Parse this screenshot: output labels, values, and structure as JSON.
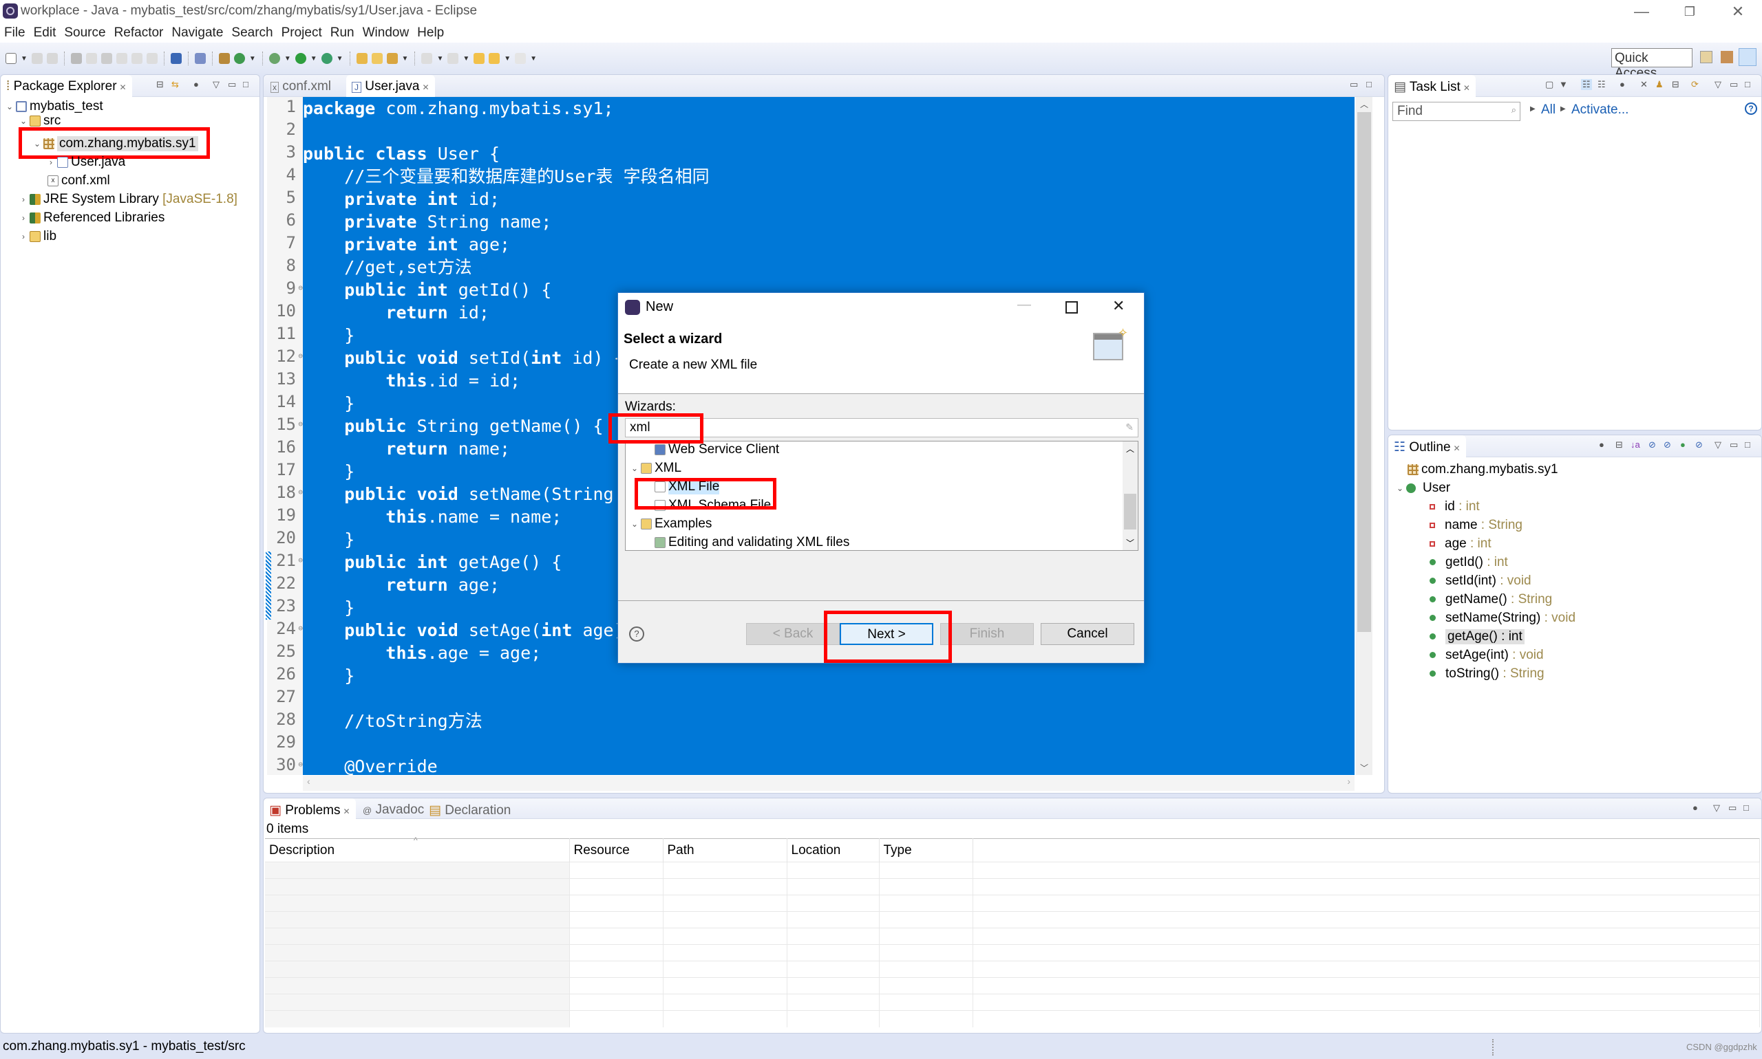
{
  "window": {
    "title": "workplace - Java - mybatis_test/src/com/zhang/mybatis/sy1/User.java - Eclipse",
    "controls": {
      "minimize": "—",
      "restore": "❐",
      "close": "✕"
    }
  },
  "menu": [
    "File",
    "Edit",
    "Source",
    "Refactor",
    "Navigate",
    "Search",
    "Project",
    "Run",
    "Window",
    "Help"
  ],
  "toolbar": {
    "quick_access": "Quick Access"
  },
  "package_explorer": {
    "tab_label": "Package Explorer",
    "tree": [
      {
        "label": "mybatis_test",
        "icon": "project-icon",
        "level": 0,
        "expanded": true
      },
      {
        "label": "src",
        "icon": "source-folder-icon",
        "level": 1,
        "expanded": true
      },
      {
        "label": "com.zhang.mybatis.sy1",
        "icon": "package-icon",
        "level": 2,
        "expanded": true,
        "selected": true
      },
      {
        "label": "User.java",
        "icon": "java-file-icon",
        "level": 3,
        "expanded": false
      },
      {
        "label": "conf.xml",
        "icon": "xml-file-icon",
        "level": 2
      },
      {
        "label": "JRE System Library",
        "decoration": "[JavaSE-1.8]",
        "icon": "library-icon",
        "level": 1,
        "expanded": false
      },
      {
        "label": "Referenced Libraries",
        "icon": "library-icon",
        "level": 1,
        "expanded": false
      },
      {
        "label": "lib",
        "icon": "folder-icon",
        "level": 1,
        "expanded": false
      }
    ]
  },
  "editor": {
    "tabs": [
      {
        "label": "conf.xml",
        "active": false
      },
      {
        "label": "User.java",
        "active": true
      }
    ],
    "lines": [
      "package com.zhang.mybatis.sy1;",
      "",
      "public class User {",
      "    //三个变量要和数据库建的User表 字段名相同",
      "    private int id;",
      "    private String name;",
      "    private int age;",
      "    //get,set方法",
      "    public int getId() {",
      "        return id;",
      "    }",
      "    public void setId(int id) {",
      "        this.id = id;",
      "    }",
      "    public String getName() {",
      "        return name;",
      "    }",
      "    public void setName(String name) {",
      "        this.name = name;",
      "    }",
      "    public int getAge() {",
      "        return age;",
      "    }",
      "    public void setAge(int age) {",
      "        this.age = age;",
      "    }",
      "",
      "    //toString方法",
      "",
      "    @Override"
    ],
    "fold_lines": [
      9,
      12,
      15,
      18,
      21,
      24,
      30
    ]
  },
  "task_list": {
    "tab_label": "Task List",
    "find_placeholder": "Find",
    "all_link": "All",
    "activate_link": "Activate...",
    "help": "?"
  },
  "outline": {
    "tab_label": "Outline",
    "items": [
      {
        "name": "com.zhang.mybatis.sy1",
        "type": "",
        "kind": "package"
      },
      {
        "name": "User",
        "type": "",
        "kind": "class"
      },
      {
        "name": "id",
        "type": " : int",
        "kind": "field"
      },
      {
        "name": "name",
        "type": " : String",
        "kind": "field"
      },
      {
        "name": "age",
        "type": " : int",
        "kind": "field"
      },
      {
        "name": "getId()",
        "type": " : int",
        "kind": "method"
      },
      {
        "name": "setId(int)",
        "type": " : void",
        "kind": "method"
      },
      {
        "name": "getName()",
        "type": " : String",
        "kind": "method"
      },
      {
        "name": "setName(String)",
        "type": " : void",
        "kind": "method"
      },
      {
        "name": "getAge()",
        "type": " : int",
        "kind": "method",
        "selected": true
      },
      {
        "name": "setAge(int)",
        "type": " : void",
        "kind": "method"
      },
      {
        "name": "toString()",
        "type": " : String",
        "kind": "method-override"
      }
    ]
  },
  "problems": {
    "tabs": [
      {
        "label": "Problems",
        "active": true
      },
      {
        "label": "Javadoc",
        "active": false
      },
      {
        "label": "Declaration",
        "active": false
      }
    ],
    "count": "0 items",
    "columns": [
      "Description",
      "Resource",
      "Path",
      "Location",
      "Type"
    ]
  },
  "status_bar": {
    "text": "com.zhang.mybatis.sy1 - mybatis_test/src",
    "watermark": "CSDN @ggdpzhk"
  },
  "dialog": {
    "title": "New",
    "heading": "Select a wizard",
    "description": "Create a new XML file",
    "wizards_label": "Wizards:",
    "filter_value": "xml",
    "tree": [
      {
        "label": "Web Service Client",
        "level": 1,
        "icon": "web-service-icon"
      },
      {
        "label": "XML",
        "level": 0,
        "icon": "folder-icon",
        "expanded": true
      },
      {
        "label": "XML File",
        "level": 1,
        "icon": "xml-file-wizard-icon",
        "selected": true
      },
      {
        "label": "XML Schema File",
        "level": 1,
        "icon": "xml-schema-icon"
      },
      {
        "label": "Examples",
        "level": 0,
        "icon": "folder-icon",
        "expanded": true
      },
      {
        "label": "Editing and validating XML files",
        "level": 1,
        "icon": "example-icon"
      }
    ],
    "buttons": {
      "help": "?",
      "back": "< Back",
      "next": "Next >",
      "finish": "Finish",
      "cancel": "Cancel"
    },
    "annotation_color": "#ff0000"
  },
  "colors": {
    "editor_selection": "#0078d7",
    "workbench_bg": "#dfe5f5",
    "annotation": "#ff0000"
  }
}
